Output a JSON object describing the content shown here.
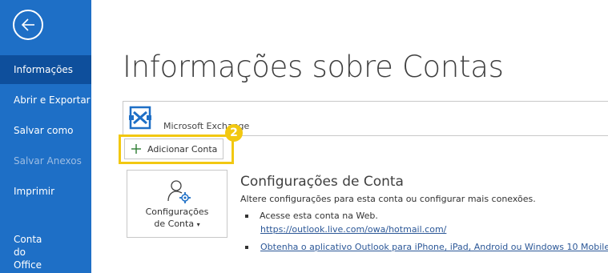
{
  "sidebar": {
    "items": [
      {
        "label": "Informações",
        "state": "active"
      },
      {
        "label": "Abrir e Exportar",
        "state": "normal"
      },
      {
        "label": "Salvar como",
        "state": "normal"
      },
      {
        "label": "Salvar Anexos",
        "state": "disabled"
      },
      {
        "label": "Imprimir",
        "state": "normal"
      },
      {
        "label": "Conta",
        "state": "normal"
      },
      {
        "label": "do",
        "state": "normal"
      },
      {
        "label": "Office",
        "state": "normal"
      }
    ],
    "back_icon": "back-arrow-icon"
  },
  "main": {
    "title": "Informações sobre Contas",
    "account": {
      "name": "Microsoft Exchange",
      "icon": "exchange-icon"
    },
    "add_account": {
      "label": "Adicionar Conta",
      "icon": "plus-icon",
      "step_badge": "2"
    },
    "settings_button": {
      "line1": "Configurações",
      "line2": "de Conta"
    },
    "section": {
      "title": "Configurações de Conta",
      "description": "Altere configurações para esta conta ou configurar mais conexões.",
      "bullet1": "Acesse esta conta na Web.",
      "link1": "https://outlook.live.com/owa/hotmail.com/",
      "link2": "Obtenha o aplicativo Outlook para iPhone, iPad, Android ou Windows 10 Mobile."
    }
  },
  "colors": {
    "sidebar_bg": "#1E6FC6",
    "sidebar_active": "#0E4F9C",
    "highlight": "#F2C811",
    "link": "#2B5797"
  }
}
